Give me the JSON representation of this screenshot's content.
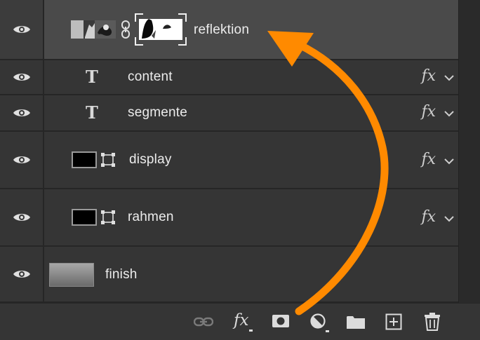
{
  "layers": [
    {
      "name": "reflektion",
      "kind": "smart-masked",
      "selected": true,
      "fx": false
    },
    {
      "name": "content",
      "kind": "text",
      "selected": false,
      "fx": true,
      "fx_label": "fx"
    },
    {
      "name": "segmente",
      "kind": "text",
      "selected": false,
      "fx": true,
      "fx_label": "fx"
    },
    {
      "name": "display",
      "kind": "artboard-shape",
      "selected": false,
      "fx": true,
      "fx_label": "fx"
    },
    {
      "name": "rahmen",
      "kind": "artboard-shape",
      "selected": false,
      "fx": true,
      "fx_label": "fx"
    },
    {
      "name": "finish",
      "kind": "gradient",
      "selected": false,
      "fx": false
    }
  ],
  "type_glyph": "T",
  "footer": {
    "icons": [
      "link-icon",
      "fx-icon",
      "mask-icon",
      "adjustment-icon",
      "folder-icon",
      "new-layer-icon",
      "trash-icon"
    ],
    "fx_label": "fx"
  },
  "colors": {
    "arrow": "#ff8a00",
    "selected_row": "#4a4a4a",
    "row": "#353535"
  }
}
